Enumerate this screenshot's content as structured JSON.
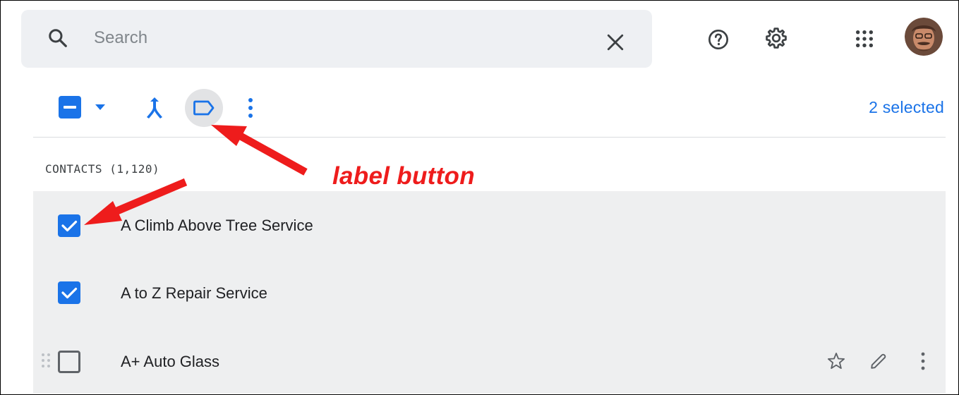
{
  "search": {
    "placeholder": "Search"
  },
  "toolbar": {
    "selected_count": "2 selected"
  },
  "contacts": {
    "header": "CONTACTS (1,120)",
    "rows": [
      {
        "name": "A Climb Above Tree Service",
        "checked": true
      },
      {
        "name": "A to Z Repair Service",
        "checked": true
      },
      {
        "name": "A+ Auto Glass",
        "checked": false
      }
    ]
  },
  "annotation": {
    "text": "label button"
  },
  "icons": {
    "search": "search-icon",
    "clear": "close-icon",
    "help": "help-circle-icon",
    "settings": "gear-icon",
    "apps": "apps-grid-icon",
    "merge": "merge-icon",
    "label": "label-icon",
    "more": "more-vert-icon",
    "star": "star-icon",
    "edit": "pencil-icon",
    "drag": "drag-handle-icon"
  },
  "colors": {
    "accent": "#1a73e8",
    "annotation": "#ee1c1c",
    "row_background": "#eeeff0",
    "search_background": "#eef0f3"
  }
}
